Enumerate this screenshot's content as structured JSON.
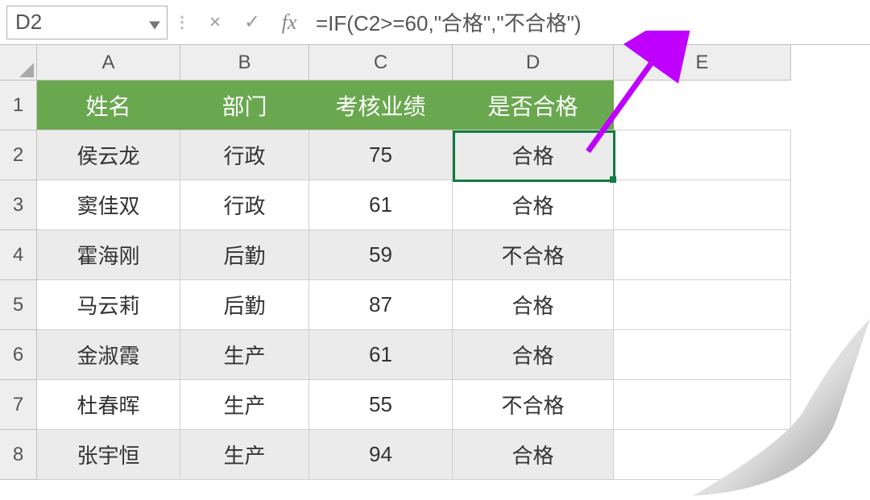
{
  "name_box": {
    "value": "D2"
  },
  "formula_bar": {
    "cancel_icon": "×",
    "confirm_icon": "✓",
    "fx_label": "fx",
    "formula": "=IF(C2>=60,\"合格\",\"不合格\")"
  },
  "columns": [
    "A",
    "B",
    "C",
    "D",
    "E"
  ],
  "row_numbers": [
    "1",
    "2",
    "3",
    "4",
    "5",
    "6",
    "7",
    "8"
  ],
  "headers": {
    "name": "姓名",
    "dept": "部门",
    "score": "考核业绩",
    "result": "是否合格"
  },
  "rows": [
    {
      "name": "侯云龙",
      "dept": "行政",
      "score": "75",
      "result": "合格"
    },
    {
      "name": "窦佳双",
      "dept": "行政",
      "score": "61",
      "result": "合格"
    },
    {
      "name": "霍海刚",
      "dept": "后勤",
      "score": "59",
      "result": "不合格"
    },
    {
      "name": "马云莉",
      "dept": "后勤",
      "score": "87",
      "result": "合格"
    },
    {
      "name": "金淑霞",
      "dept": "生产",
      "score": "61",
      "result": "合格"
    },
    {
      "name": "杜春晖",
      "dept": "生产",
      "score": "55",
      "result": "不合格"
    },
    {
      "name": "张宇恒",
      "dept": "生产",
      "score": "94",
      "result": "合格"
    }
  ],
  "selection": {
    "cell": "D2"
  },
  "colors": {
    "header_bg": "#6aa84f",
    "selection": "#107c41",
    "arrow": "#c000ff"
  },
  "chart_data": {
    "type": "table",
    "title": "",
    "columns": [
      "姓名",
      "部门",
      "考核业绩",
      "是否合格"
    ],
    "records": [
      [
        "侯云龙",
        "行政",
        75,
        "合格"
      ],
      [
        "窦佳双",
        "行政",
        61,
        "合格"
      ],
      [
        "霍海刚",
        "后勤",
        59,
        "不合格"
      ],
      [
        "马云莉",
        "后勤",
        87,
        "合格"
      ],
      [
        "金淑霞",
        "生产",
        61,
        "合格"
      ],
      [
        "杜春晖",
        "生产",
        55,
        "不合格"
      ],
      [
        "张宇恒",
        "生产",
        94,
        "合格"
      ]
    ],
    "formula": "=IF(C2>=60,\"合格\",\"不合格\")"
  }
}
